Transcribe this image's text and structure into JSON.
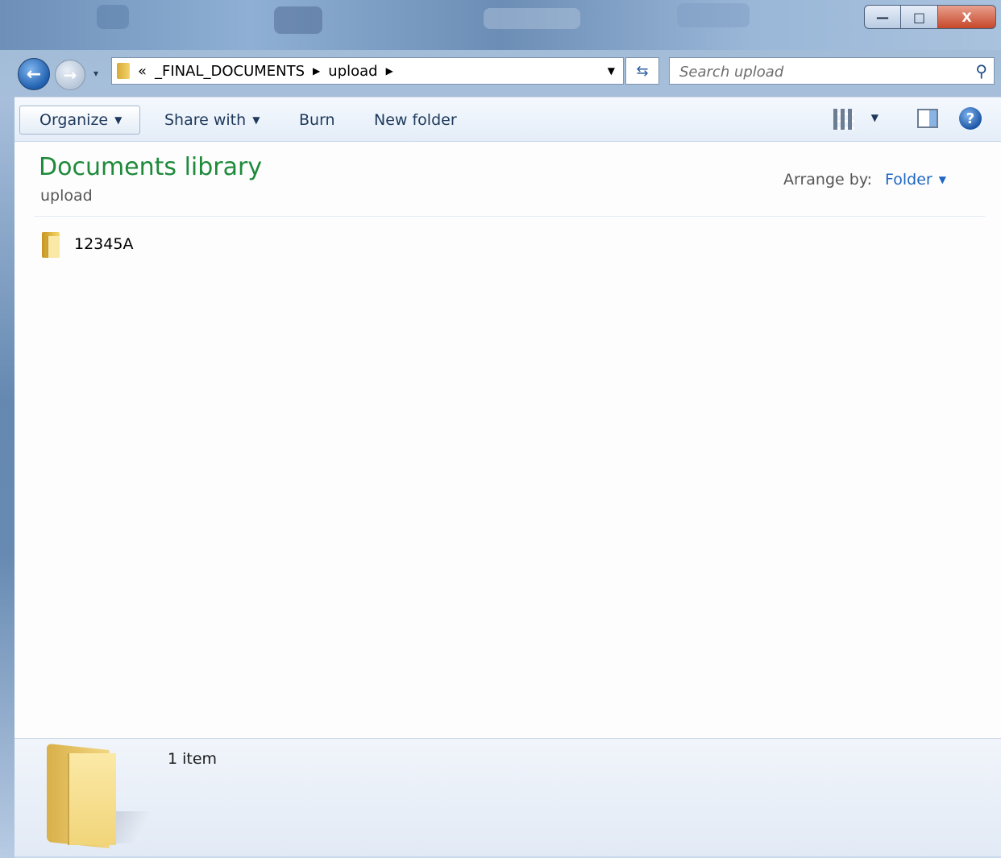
{
  "window": {
    "controls": {
      "minimize": "—",
      "maximize": "□",
      "close": "X"
    }
  },
  "nav": {
    "back_glyph": "←",
    "forward_glyph": "→",
    "breadcrumb_overflow": "«",
    "breadcrumbs": [
      "_FINAL_DOCUMENTS",
      "upload"
    ],
    "refresh_glyph": "⇆"
  },
  "search": {
    "placeholder": "Search upload",
    "icon": "search-icon"
  },
  "toolbar": {
    "organize": "Organize",
    "share_with": "Share with",
    "burn": "Burn",
    "new_folder": "New folder",
    "help_glyph": "?"
  },
  "library": {
    "title": "Documents library",
    "subtitle": "upload",
    "arrange_label": "Arrange by:",
    "arrange_value": "Folder"
  },
  "items": [
    {
      "name": "12345A",
      "icon": "folder-icon"
    }
  ],
  "details": {
    "count_text": "1 item"
  },
  "colors": {
    "title_green": "#1e8a3a",
    "link_blue": "#1f66c2",
    "close_red": "#c6472a"
  }
}
